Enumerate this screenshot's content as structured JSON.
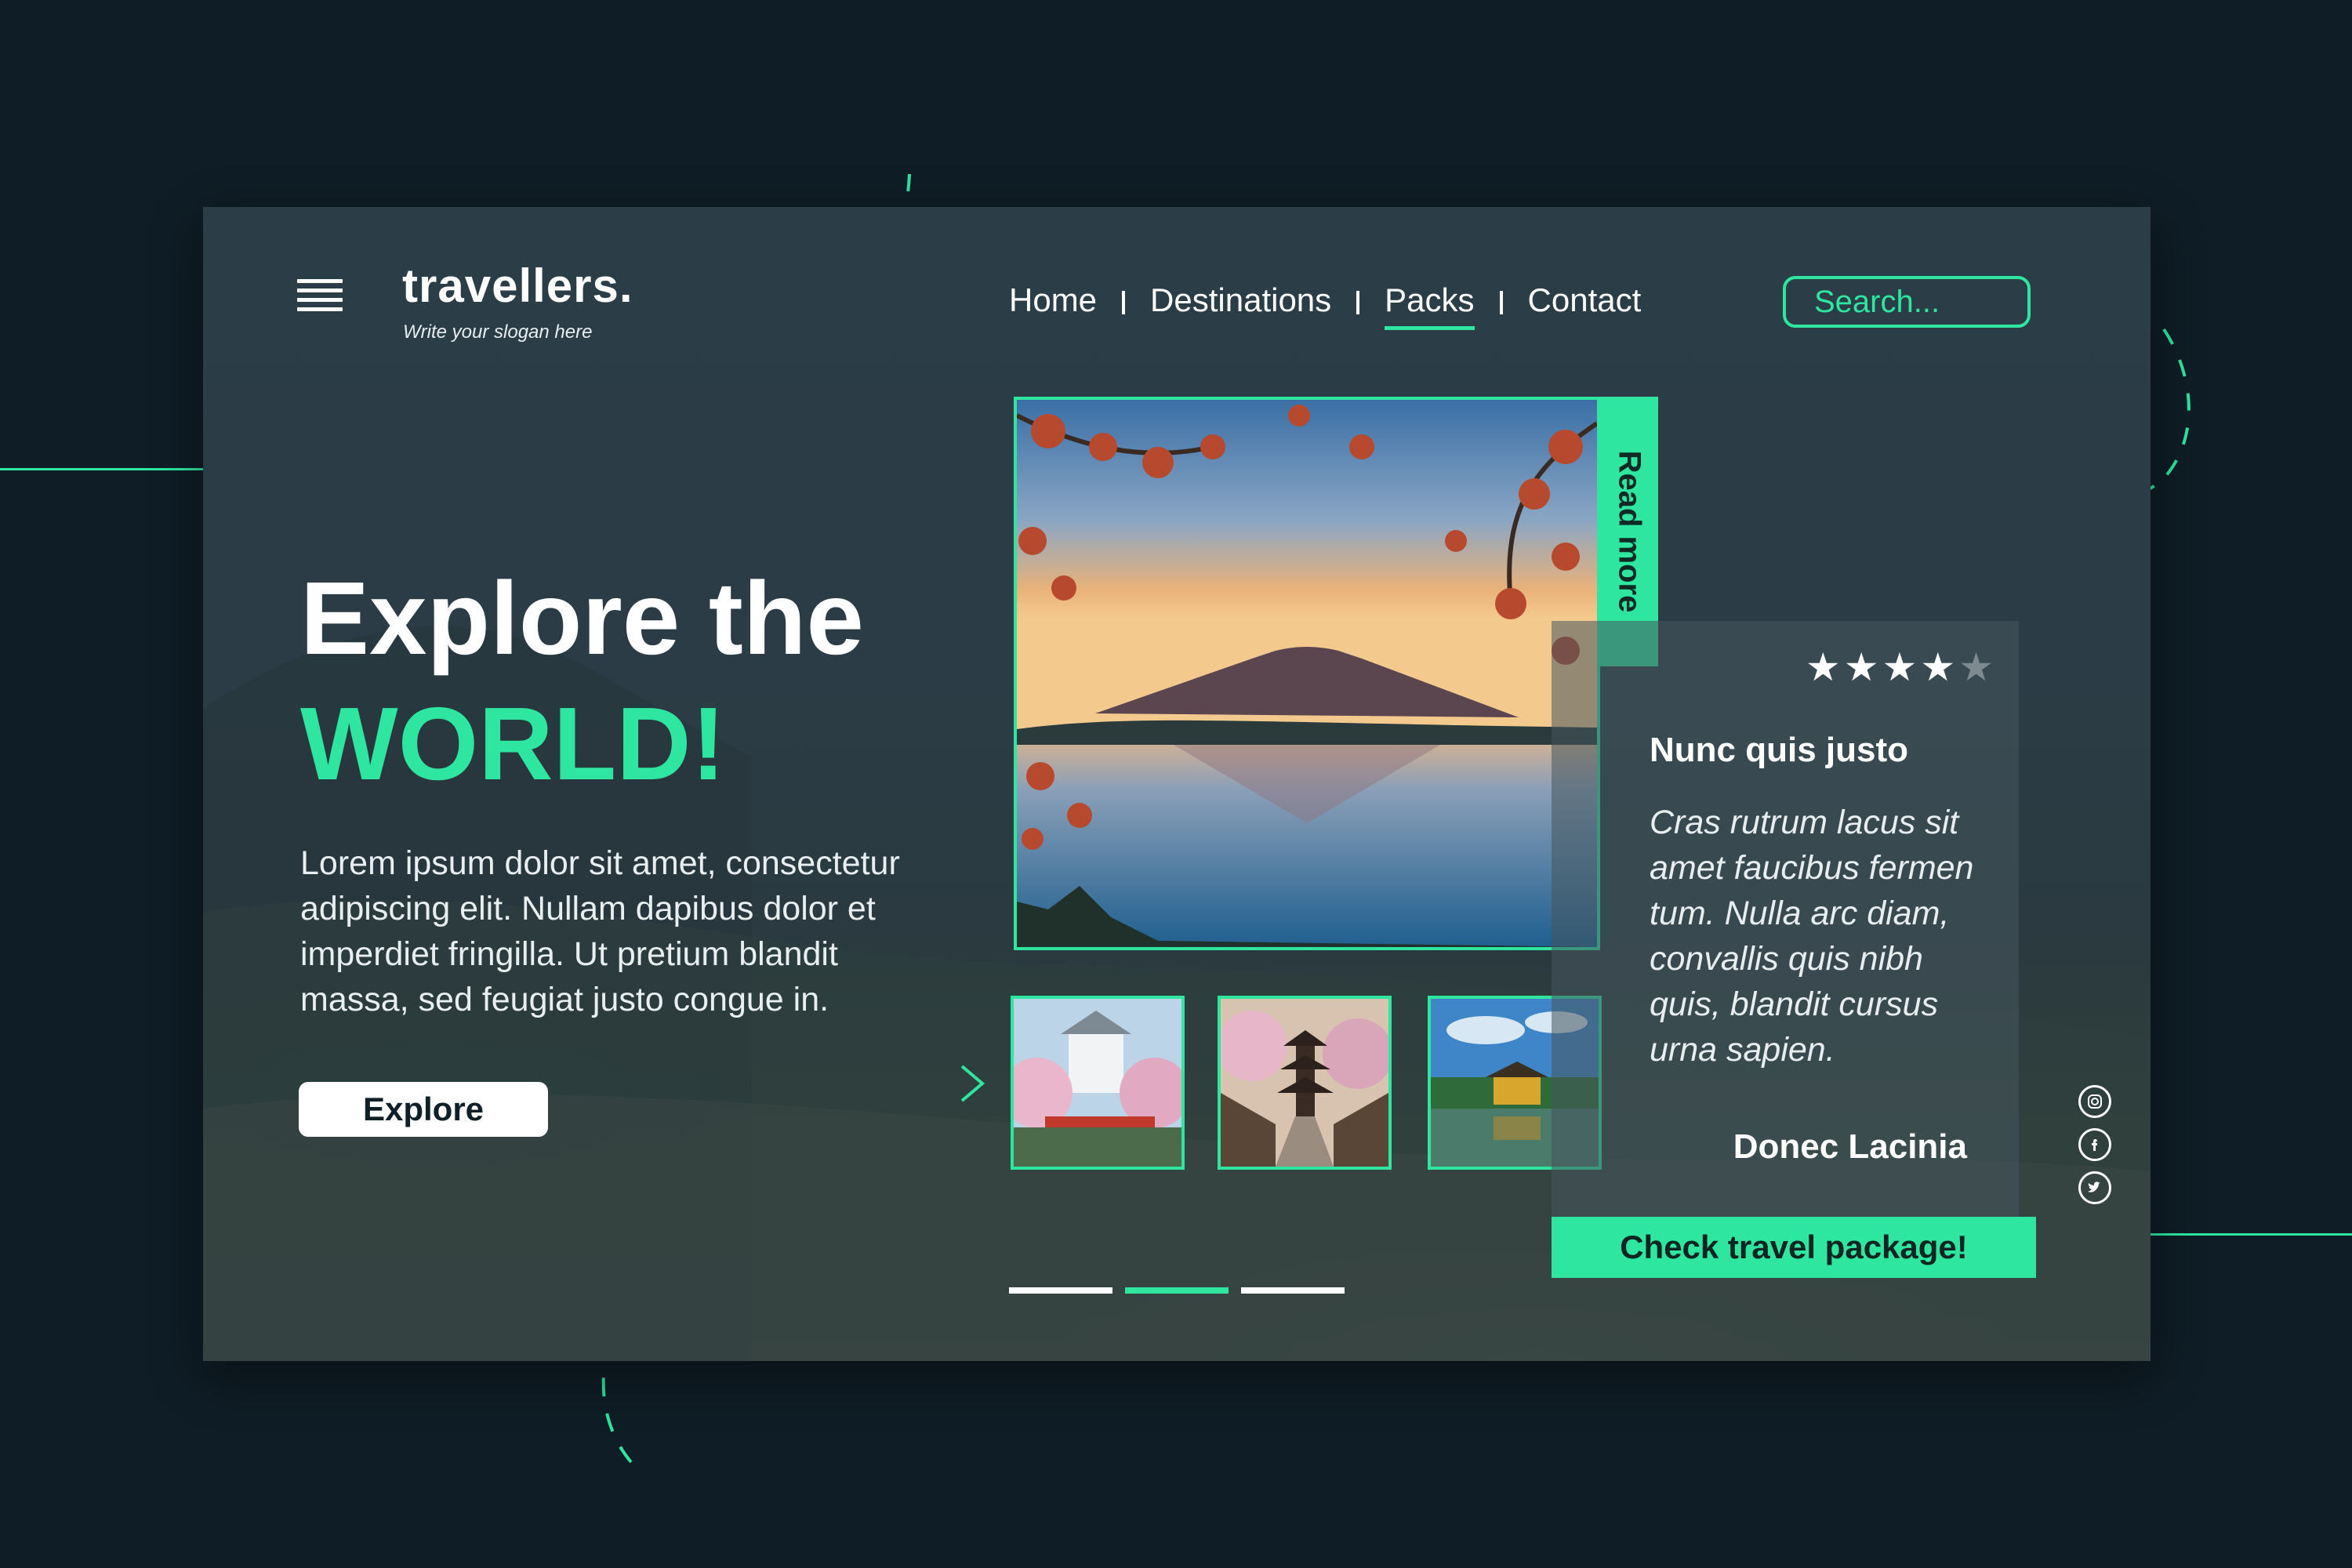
{
  "brand": {
    "name": "travellers.",
    "slogan": "Write your slogan here"
  },
  "nav": {
    "items": [
      {
        "label": "Home",
        "active": false
      },
      {
        "label": "Destinations",
        "active": false
      },
      {
        "label": "Packs",
        "active": true
      },
      {
        "label": "Contact",
        "active": false
      }
    ]
  },
  "search": {
    "placeholder": "Search..."
  },
  "hero": {
    "title": "Explore the",
    "accent": "WORLD!",
    "body": "Lorem ipsum dolor sit amet, consectetur adipiscing elit. Nullam dapibus dolor et imperdiet fringilla. Ut pretium blandit massa, sed feugiat justo congue in.",
    "button_label": "Explore"
  },
  "feature": {
    "read_more": "Read more"
  },
  "review": {
    "rating": 4,
    "max_rating": 5,
    "title": "Nunc quis justo",
    "body": "Cras rutrum lacus sit amet faucibus fermen tum. Nulla arc diam, convallis quis nibh quis, blandit cursus urna sapien.",
    "author": "Donec Lacinia",
    "cta": "Check travel package!"
  },
  "social": [
    "instagram-icon",
    "facebook-icon",
    "twitter-icon"
  ],
  "pagination": {
    "count": 3,
    "active_index": 1
  },
  "colors": {
    "accent": "#2ee6a0",
    "background": "#0f1d26",
    "card": "#2b3d47"
  }
}
